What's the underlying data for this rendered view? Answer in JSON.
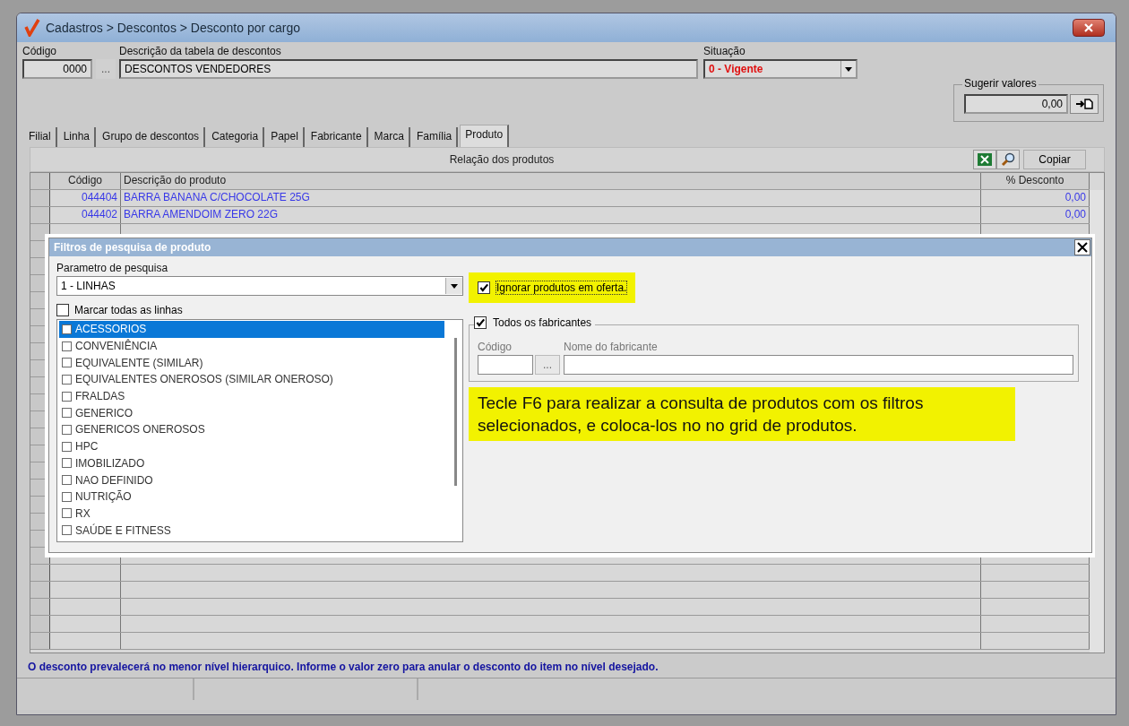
{
  "window": {
    "title": "Cadastros > Descontos > Desconto por cargo"
  },
  "form": {
    "codigo_label": "Código",
    "codigo_value": "0000",
    "lookup_button": "...",
    "descricao_label": "Descrição da tabela de descontos",
    "descricao_value": "DESCONTOS VENDEDORES",
    "situacao_label": "Situação",
    "situacao_value": "0 - Vigente"
  },
  "sugerir": {
    "label": "Sugerir valores",
    "value": "0,00"
  },
  "tabs": [
    {
      "label": "Filial",
      "selected": false
    },
    {
      "label": "Linha",
      "selected": false
    },
    {
      "label": "Grupo de descontos",
      "selected": false
    },
    {
      "label": "Categoria",
      "selected": false
    },
    {
      "label": "Papel",
      "selected": false
    },
    {
      "label": "Fabricante",
      "selected": false
    },
    {
      "label": "Marca",
      "selected": false
    },
    {
      "label": "Família",
      "selected": false
    },
    {
      "label": "Produto",
      "selected": true
    }
  ],
  "grid": {
    "title": "Relação dos produtos",
    "copy_button": "Copiar",
    "columns": [
      "Código",
      "Descrição do produto",
      "% Desconto"
    ],
    "rows": [
      {
        "code": "044404",
        "description": "BARRA BANANA C/CHOCOLATE 25G",
        "discount": "0,00",
        "current": false
      },
      {
        "code": "044402",
        "description": "BARRA AMENDOIM ZERO 22G",
        "discount": "0,00",
        "current": false
      }
    ]
  },
  "dialog": {
    "title": "Filtros de pesquisa de produto",
    "param_label": "Parametro de pesquisa",
    "param_value": "1 - LINHAS",
    "mark_all": {
      "label": "Marcar todas as linhas",
      "checked": false
    },
    "lines": [
      {
        "label": "ACESSORIOS",
        "checked": false,
        "selected": true
      },
      {
        "label": "CONVENIÊNCIA",
        "checked": false,
        "selected": false
      },
      {
        "label": "EQUIVALENTE (SIMILAR)",
        "checked": false,
        "selected": false
      },
      {
        "label": "EQUIVALENTES ONEROSOS (SIMILAR ONEROSO)",
        "checked": false,
        "selected": false
      },
      {
        "label": "FRALDAS",
        "checked": false,
        "selected": false
      },
      {
        "label": "GENERICO",
        "checked": false,
        "selected": false
      },
      {
        "label": "GENERICOS ONEROSOS",
        "checked": false,
        "selected": false
      },
      {
        "label": "HPC",
        "checked": false,
        "selected": false
      },
      {
        "label": "IMOBILIZADO",
        "checked": false,
        "selected": false
      },
      {
        "label": "NAO DEFINIDO",
        "checked": false,
        "selected": false
      },
      {
        "label": "NUTRIÇÃO",
        "checked": false,
        "selected": false
      },
      {
        "label": "RX",
        "checked": false,
        "selected": false
      },
      {
        "label": "SAÚDE E FITNESS",
        "checked": false,
        "selected": false
      }
    ],
    "ignore_offers": {
      "label": "Ignorar produtos em oferta.",
      "checked": true
    },
    "all_manufacturers": {
      "label": "Todos os fabricantes",
      "checked": true
    },
    "manu_code_label": "Código",
    "manu_lookup": "...",
    "manu_name_label": "Nome do fabricante",
    "hint": "Tecle F6 para realizar a consulta de produtos com os filtros selecionados, e coloca-los no no grid de produtos."
  },
  "status_message": "O desconto prevalecerá no menor nível hierarquico. Informe o valor zero para anular o desconto do item no nível desejado."
}
